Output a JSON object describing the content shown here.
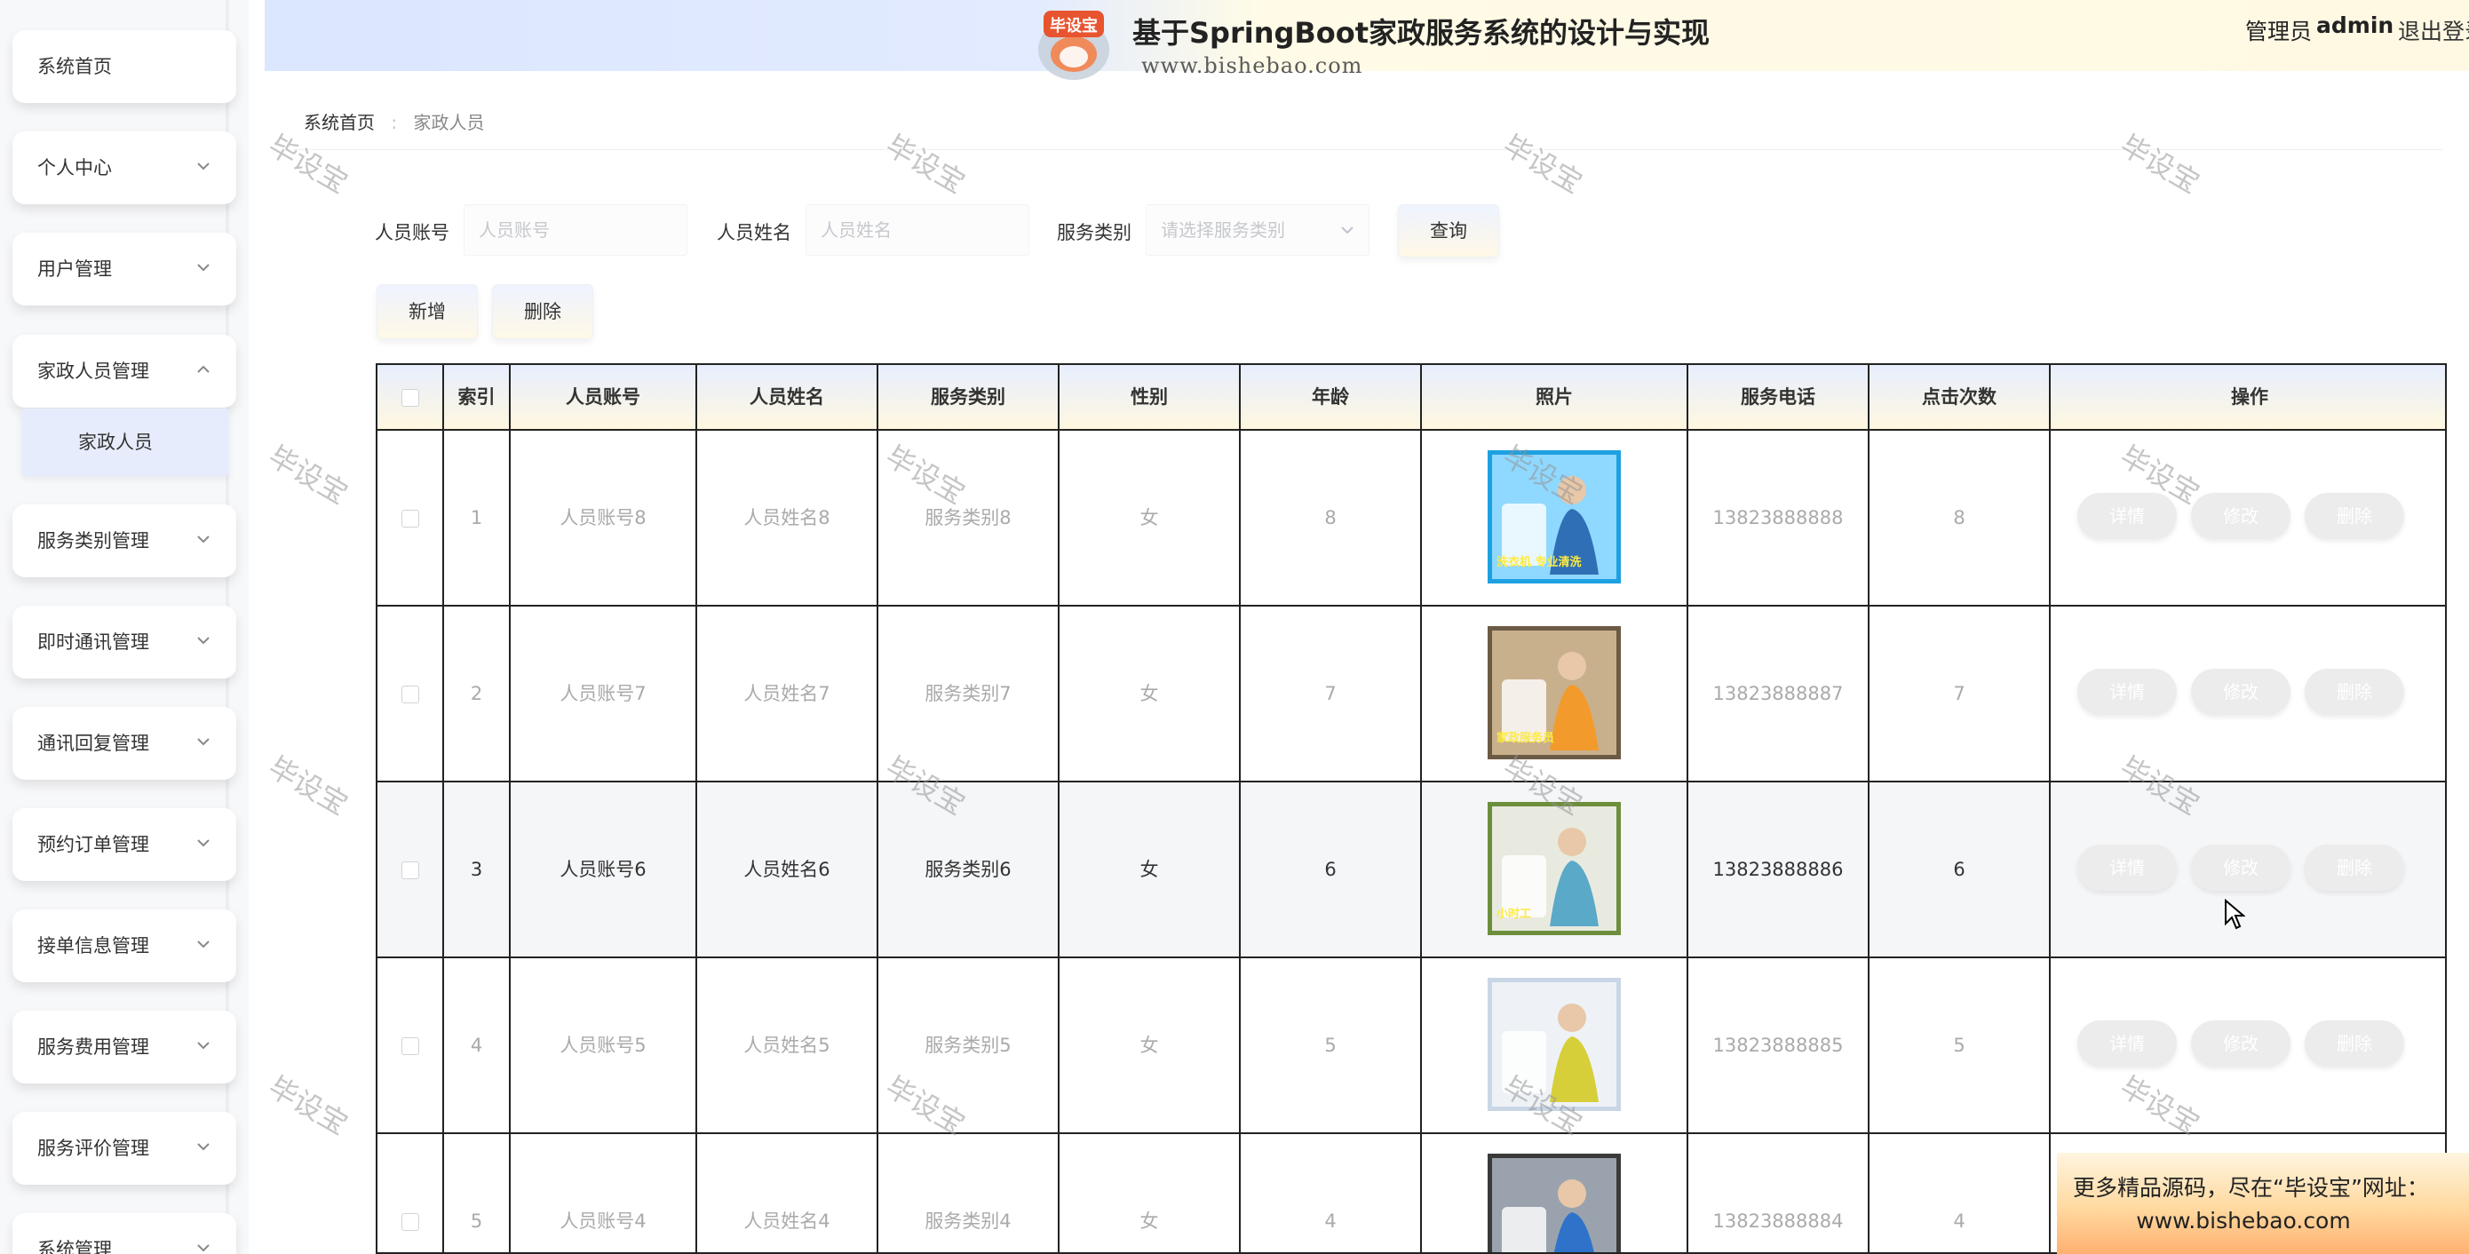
{
  "header": {
    "title": "基于SpringBoot家政服务系统的设计与实现",
    "admin_label": "管理员",
    "admin_name": "admin",
    "logout": "退出登录",
    "logo_text": "毕设宝",
    "site_url": "www.bishebao.com"
  },
  "sidebar": {
    "items": [
      {
        "label": "系统首页",
        "chevron": false
      },
      {
        "label": "个人中心",
        "chevron": "down"
      },
      {
        "label": "用户管理",
        "chevron": "down"
      },
      {
        "label": "家政人员管理",
        "chevron": "up"
      },
      {
        "label": "服务类别管理",
        "chevron": "down"
      },
      {
        "label": "即时通讯管理",
        "chevron": "down"
      },
      {
        "label": "通讯回复管理",
        "chevron": "down"
      },
      {
        "label": "预约订单管理",
        "chevron": "down"
      },
      {
        "label": "接单信息管理",
        "chevron": "down"
      },
      {
        "label": "服务费用管理",
        "chevron": "down"
      },
      {
        "label": "服务评价管理",
        "chevron": "down"
      },
      {
        "label": "系统管理",
        "chevron": "down"
      }
    ],
    "submenu_label": "家政人员"
  },
  "breadcrumb": {
    "home": "系统首页",
    "current": "家政人员"
  },
  "search": {
    "account_label": "人员账号",
    "account_placeholder": "人员账号",
    "name_label": "人员姓名",
    "name_placeholder": "人员姓名",
    "category_label": "服务类别",
    "category_placeholder": "请选择服务类别",
    "query_button": "查询"
  },
  "toolbar": {
    "add_button": "新增",
    "delete_button": "删除"
  },
  "table": {
    "headers": [
      "索引",
      "人员账号",
      "人员姓名",
      "服务类别",
      "性别",
      "年龄",
      "照片",
      "服务电话",
      "点击次数",
      "操作"
    ],
    "rows": [
      {
        "index": "1",
        "account": "人员账号8",
        "name": "人员姓名8",
        "category": "服务类别8",
        "gender": "女",
        "age": "8",
        "phone": "13823888888",
        "clicks": "8",
        "photo_label": "洗衣机 专业清洗"
      },
      {
        "index": "2",
        "account": "人员账号7",
        "name": "人员姓名7",
        "category": "服务类别7",
        "gender": "女",
        "age": "7",
        "phone": "13823888887",
        "clicks": "7",
        "photo_label": "家政服务员"
      },
      {
        "index": "3",
        "account": "人员账号6",
        "name": "人员姓名6",
        "category": "服务类别6",
        "gender": "女",
        "age": "6",
        "phone": "13823888886",
        "clicks": "6",
        "photo_label": "小时工"
      },
      {
        "index": "4",
        "account": "人员账号5",
        "name": "人员姓名5",
        "category": "服务类别5",
        "gender": "女",
        "age": "5",
        "phone": "13823888885",
        "clicks": "5",
        "photo_label": ""
      },
      {
        "index": "5",
        "account": "人员账号4",
        "name": "人员姓名4",
        "category": "服务类别4",
        "gender": "女",
        "age": "4",
        "phone": "13823888884",
        "clicks": "4",
        "photo_label": ""
      }
    ],
    "actions": {
      "detail": "详情",
      "edit": "修改",
      "delete": "删除"
    },
    "hover_row": 3
  },
  "watermark_text": "毕设宝",
  "promo": {
    "line1": "更多精品源码，尽在“毕设宝”网址：",
    "line2": "www.bishebao.com"
  },
  "colors": {
    "header_left": "#dbe6ff",
    "header_right": "#fff9e3",
    "border": "#222222",
    "promo": "#ffb070"
  }
}
